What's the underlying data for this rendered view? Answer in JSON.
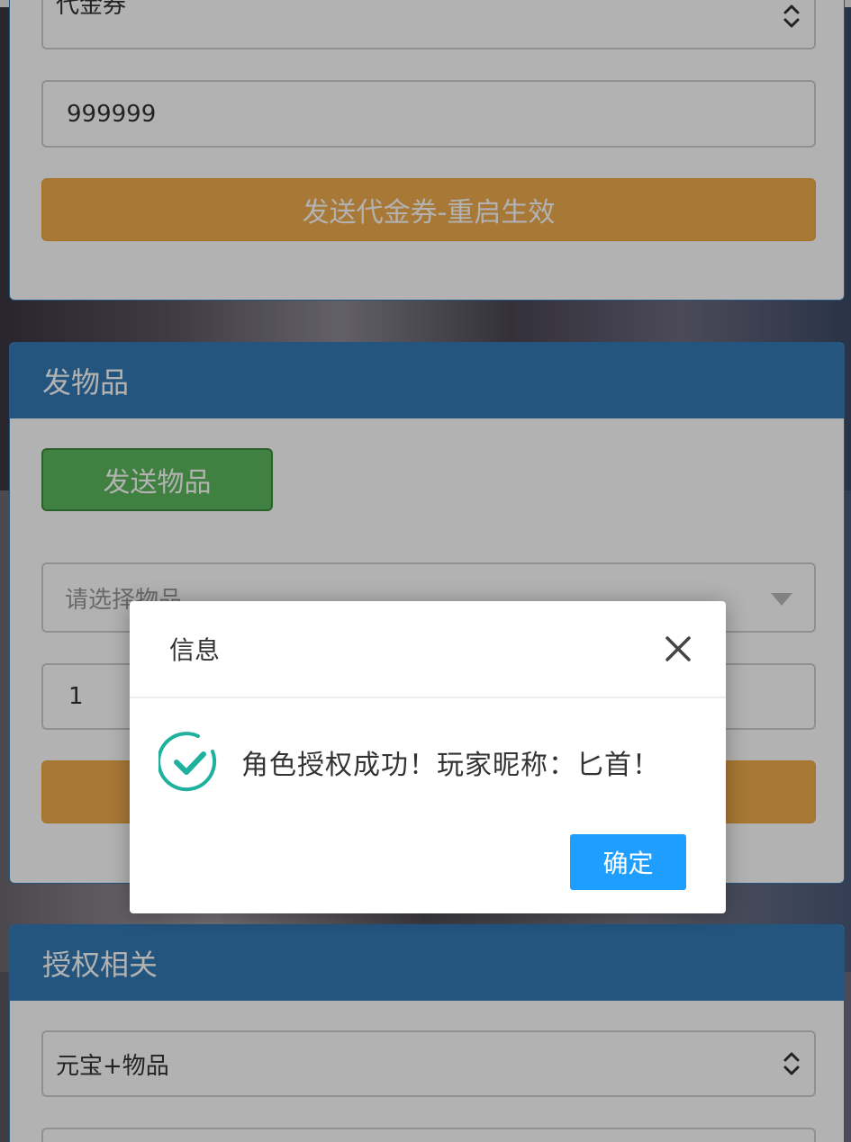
{
  "coupon_panel": {
    "coupon_type_value": "代金券",
    "amount_value": "999999",
    "send_button": "发送代金券-重启生效"
  },
  "items_panel": {
    "title": "发物品",
    "send_button": "发送物品",
    "item_select_placeholder": "请选择物品",
    "quantity_value": "1"
  },
  "auth_panel": {
    "title": "授权相关",
    "type_value": "元宝+物品"
  },
  "dialog": {
    "title": "信息",
    "message": "角色授权成功！玩家昵称：匕首！",
    "confirm_button": "确定"
  },
  "colors": {
    "panel_primary": "#337ab7",
    "warning": "#f0ad4e",
    "success": "#5cb85c",
    "dialog_button": "#1e9fff",
    "success_icon": "#1fb19e"
  }
}
